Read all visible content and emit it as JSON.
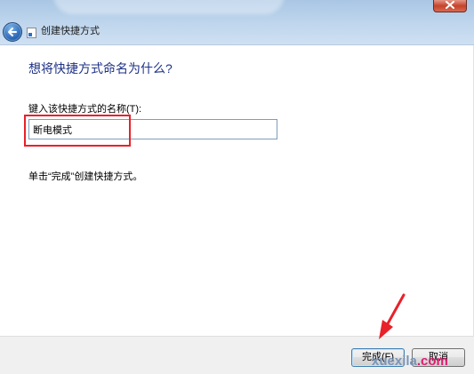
{
  "window": {
    "title": "创建快捷方式"
  },
  "page": {
    "heading": "想将快捷方式命名为什么?",
    "field_label": "键入该快捷方式的名称(T):",
    "name_value": "断电模式",
    "hint": "单击“完成”创建快捷方式。"
  },
  "buttons": {
    "finish_label": "完成(F)",
    "cancel_label": "取消"
  },
  "watermark": {
    "text_main": "xuexila",
    "text_accent": ".com"
  },
  "colors": {
    "heading": "#1e3287",
    "highlight": "#e8212a",
    "titlebar": "#bcd4ec"
  },
  "icons": [
    "back-arrow-icon",
    "shortcut-icon",
    "close-icon"
  ]
}
